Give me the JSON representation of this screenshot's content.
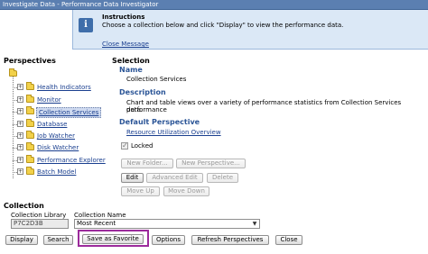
{
  "window": {
    "title": "Investigate Data - Performance Data Investigator"
  },
  "instructions": {
    "title": "Instructions",
    "text": "Choose a collection below and click \"Display\" to view the performance data.",
    "close_link": "Close Message",
    "icon": "info-icon"
  },
  "perspectives": {
    "heading": "Perspectives",
    "items": [
      {
        "label": "Health Indicators",
        "selected": false
      },
      {
        "label": "Monitor",
        "selected": false
      },
      {
        "label": "Collection Services",
        "selected": true
      },
      {
        "label": "Database",
        "selected": false
      },
      {
        "label": "Job Watcher",
        "selected": false
      },
      {
        "label": "Disk Watcher",
        "selected": false
      },
      {
        "label": "Performance Explorer",
        "selected": false
      },
      {
        "label": "Batch Model",
        "selected": false
      }
    ]
  },
  "selection": {
    "heading": "Selection",
    "name_label": "Name",
    "name_value": "Collection Services",
    "description_label": "Description",
    "description_line1": "Chart and table views over a variety of performance statistics from Collection Services performance",
    "description_line2": "data.",
    "default_label": "Default Perspective",
    "default_link": "Resource Utilization Overview",
    "locked_label": "Locked",
    "locked_checked": true,
    "buttons": {
      "new_folder": "New Folder...",
      "new_perspective": "New Perspective...",
      "edit": "Edit",
      "advanced_edit": "Advanced Edit",
      "delete": "Delete",
      "move_up": "Move Up",
      "move_down": "Move Down"
    }
  },
  "collection": {
    "heading": "Collection",
    "library_label": "Collection Library",
    "library_value": "P7C2D3B",
    "name_label": "Collection Name",
    "name_value": "Most Recent"
  },
  "bottom_buttons": {
    "display": "Display",
    "search": "Search",
    "save_favorite": "Save as Favorite",
    "options": "Options",
    "refresh": "Refresh Perspectives",
    "close": "Close"
  },
  "colors": {
    "titlebar": "#5b7fb1",
    "info_bg": "#dbe8f6",
    "heading_blue": "#2b5597",
    "highlight": "#9c2b9c"
  }
}
